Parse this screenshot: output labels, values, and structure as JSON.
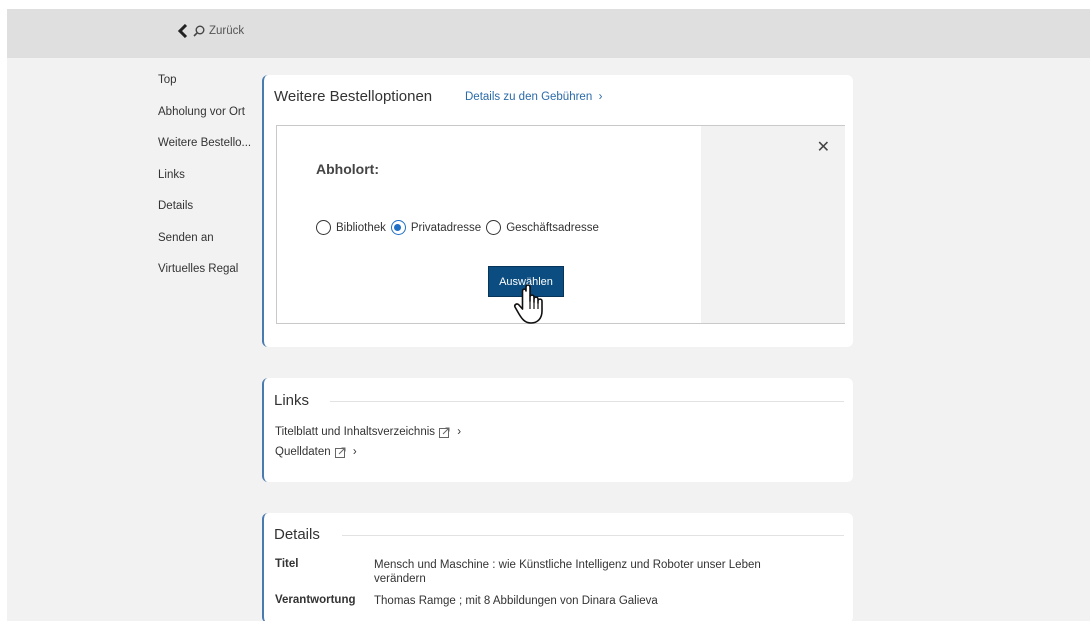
{
  "header": {
    "back_label": "Zurück"
  },
  "sidebar": {
    "items": [
      {
        "label": "Top"
      },
      {
        "label": "Abholung vor Ort"
      },
      {
        "label": "Weitere Bestello..."
      },
      {
        "label": "Links"
      },
      {
        "label": "Details"
      },
      {
        "label": "Senden an"
      },
      {
        "label": "Virtuelles Regal"
      }
    ]
  },
  "order_options": {
    "title": "Weitere Bestelloptionen",
    "fees_link": "Details zu den Gebühren",
    "dialog": {
      "heading": "Abholort:",
      "options": [
        {
          "label": "Bibliothek",
          "selected": false
        },
        {
          "label": "Privatadresse",
          "selected": true
        },
        {
          "label": "Geschäftsadresse",
          "selected": false
        }
      ],
      "submit_label": "Auswählen"
    }
  },
  "links": {
    "title": "Links",
    "items": [
      {
        "label": "Titelblatt und Inhaltsverzeichnis"
      },
      {
        "label": "Quelldaten"
      }
    ]
  },
  "details": {
    "title": "Details",
    "rows": [
      {
        "key": "Titel",
        "value": "Mensch und Maschine : wie Künstliche Intelligenz und Roboter unser Leben verändern"
      },
      {
        "key": "Verantwortung",
        "value": "Thomas Ramge ; mit 8 Abbildungen von Dinara Galieva"
      }
    ]
  },
  "colors": {
    "accent": "#0b4d80",
    "link": "#2a6aa8",
    "radio_selected": "#1f6fc5"
  }
}
